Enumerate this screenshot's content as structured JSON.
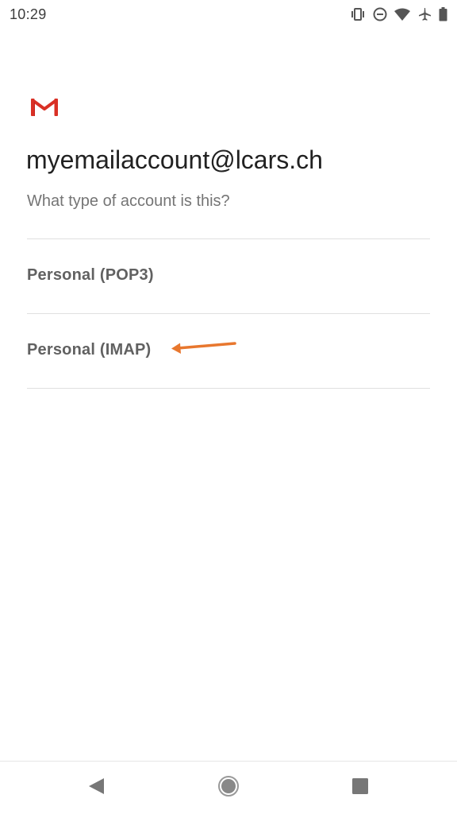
{
  "status_bar": {
    "time": "10:29",
    "icons": [
      "vibrate-icon",
      "do-not-disturb-icon",
      "wifi-icon",
      "airplane-mode-icon",
      "battery-icon"
    ]
  },
  "app": {
    "logo": "gmail-logo",
    "brand_color": "#d93025"
  },
  "account": {
    "email": "myemailaccount@lcars.ch",
    "question": "What type of account is this?"
  },
  "options": [
    {
      "label": "Personal (POP3)"
    },
    {
      "label": "Personal (IMAP)"
    }
  ],
  "annotation": {
    "arrow_color": "#e8772e",
    "points_to": "Personal (IMAP)"
  },
  "nav_bar": {
    "buttons": [
      "back-icon",
      "home-icon",
      "recents-icon"
    ]
  }
}
